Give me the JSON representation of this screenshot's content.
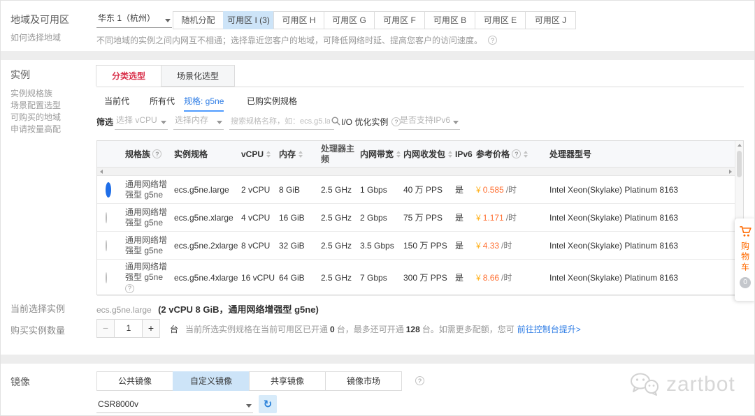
{
  "icons": {
    "help": "?",
    "refresh": "↻"
  },
  "region": {
    "label": "地域及可用区",
    "helper_link": "如何选择地域",
    "selected_region": "华东 1（杭州）",
    "zones": [
      {
        "label": "随机分配"
      },
      {
        "label": "可用区 I (3)"
      },
      {
        "label": "可用区 H"
      },
      {
        "label": "可用区 G"
      },
      {
        "label": "可用区 F"
      },
      {
        "label": "可用区 B"
      },
      {
        "label": "可用区 E"
      },
      {
        "label": "可用区 J"
      }
    ],
    "note": "不同地域的实例之间内网互不相通；选择靠近您客户的地域，可降低网络时延、提高您客户的访问速度。"
  },
  "instance": {
    "label": "实例",
    "side_links": [
      {
        "label": "实例规格族"
      },
      {
        "label": "场景配置选型"
      },
      {
        "label": "可购买的地域"
      },
      {
        "label": "申请按量高配"
      }
    ],
    "tabs": [
      {
        "label": "分类选型"
      },
      {
        "label": "场景化选型"
      }
    ],
    "subtabs": [
      {
        "label": "当前代"
      },
      {
        "label": "所有代"
      },
      {
        "label": "规格: g5ne"
      },
      {
        "label": "已购实例规格"
      }
    ],
    "filter": {
      "label": "筛选",
      "vcpu_placeholder": "选择 vCPU",
      "memory_placeholder": "选择内存",
      "search_placeholder": "搜索规格名称，如：ecs.g5.large",
      "io_label": "I/O 优化实例",
      "ipv6_placeholder": "是否支持IPv6"
    },
    "table": {
      "headers": {
        "family": "规格族",
        "spec": "实例规格",
        "vcpu": "vCPU",
        "memory": "内存",
        "frequency": "处理器主频",
        "bandwidth": "内网带宽",
        "pps": "内网收发包",
        "ipv6": "IPv6",
        "price": "参考价格",
        "cpu": "处理器型号"
      },
      "rows": [
        {
          "family": "通用网络增强型 g5ne",
          "spec": "ecs.g5ne.large",
          "vcpu": "2 vCPU",
          "memory": "8 GiB",
          "frequency": "2.5 GHz",
          "bandwidth": "1 Gbps",
          "pps": "40 万 PPS",
          "ipv6": "是",
          "currency": "¥",
          "price": "0.585",
          "price_unit": "/时",
          "cpu": "Intel Xeon(Skylake) Platinum 8163"
        },
        {
          "family": "通用网络增强型 g5ne",
          "spec": "ecs.g5ne.xlarge",
          "vcpu": "4 vCPU",
          "memory": "16 GiB",
          "frequency": "2.5 GHz",
          "bandwidth": "2 Gbps",
          "pps": "75 万 PPS",
          "ipv6": "是",
          "currency": "¥",
          "price": "1.171",
          "price_unit": "/时",
          "cpu": "Intel Xeon(Skylake) Platinum 8163"
        },
        {
          "family": "通用网络增强型 g5ne",
          "spec": "ecs.g5ne.2xlarge",
          "vcpu": "8 vCPU",
          "memory": "32 GiB",
          "frequency": "2.5 GHz",
          "bandwidth": "3.5 Gbps",
          "pps": "150 万 PPS",
          "ipv6": "是",
          "currency": "¥",
          "price": "4.33",
          "price_unit": "/时",
          "cpu": "Intel Xeon(Skylake) Platinum 8163"
        },
        {
          "family": "通用网络增强型 g5ne",
          "spec": "ecs.g5ne.4xlarge",
          "vcpu": "16 vCPU",
          "memory": "64 GiB",
          "frequency": "2.5 GHz",
          "bandwidth": "7 Gbps",
          "pps": "300 万 PPS",
          "ipv6": "是",
          "currency": "¥",
          "price": "8.66",
          "price_unit": "/时",
          "cpu": "Intel Xeon(Skylake) Platinum 8163"
        }
      ]
    }
  },
  "current_selection": {
    "label": "当前选择实例",
    "spec": "ecs.g5ne.large",
    "detail": "(2 vCPU 8 GiB，通用网络增强型 g5ne)"
  },
  "quantity": {
    "label": "购买实例数量",
    "minus": "−",
    "value": "1",
    "plus": "+",
    "unit": "台",
    "note_1": "当前所选实例规格在当前可用区已开通",
    "opened": "0",
    "note_2": "台，最多还可开通",
    "max": "128",
    "note_3": "台。如需更多配额，您可",
    "link": "前往控制台提升>"
  },
  "image": {
    "label": "镜像",
    "types": [
      {
        "label": "公共镜像"
      },
      {
        "label": "自定义镜像"
      },
      {
        "label": "共享镜像"
      },
      {
        "label": "镜像市场"
      }
    ],
    "selected_image": "CSR8000v"
  },
  "cart": {
    "label": "购物车",
    "badge": "0"
  },
  "watermark": "zartbot"
}
